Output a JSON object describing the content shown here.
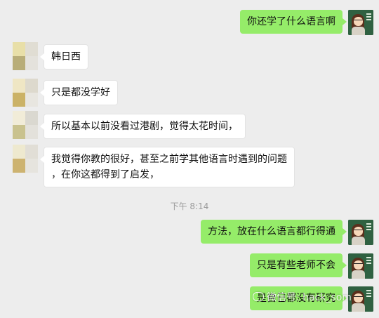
{
  "timestamp": "下午 8:14",
  "messages": [
    {
      "side": "out",
      "text": "你还学了什么语言啊"
    },
    {
      "side": "in",
      "text": "韩日西"
    },
    {
      "side": "in",
      "text": "只是都没学好"
    },
    {
      "side": "in",
      "text": "所以基本以前没看过港剧，觉得太花时间，"
    },
    {
      "side": "in",
      "lines": [
        "我觉得你教的很好，甚至之前学其他语言时遇到的问题",
        "，在你这都得到了启发，"
      ]
    },
    {
      "side": "out",
      "text": "方法，放在什么语言都行得通"
    },
    {
      "side": "out",
      "text": "只是有些老师不会"
    },
    {
      "side": "out",
      "text": "是自己都没有研究"
    }
  ],
  "watermark": "微信号: hack_som",
  "avatar_colors": {
    "incoming_1": [
      "#e8dfa8",
      "#d9d7c8",
      "#c2bb8c",
      "#e4e2dc"
    ],
    "incoming_2": [
      "#efe6c4",
      "#ddd9cd",
      "#cbb266",
      "#e8e6e0"
    ],
    "incoming_3": [
      "#f1ecd8",
      "#dad8d0",
      "#c9c28e",
      "#e3e1db"
    ],
    "incoming_4": [
      "#eee9cf",
      "#e1ded6",
      "#cdb370",
      "#e6e4de"
    ],
    "outgoing_bubble": "#95ec69",
    "background": "#ededed"
  }
}
